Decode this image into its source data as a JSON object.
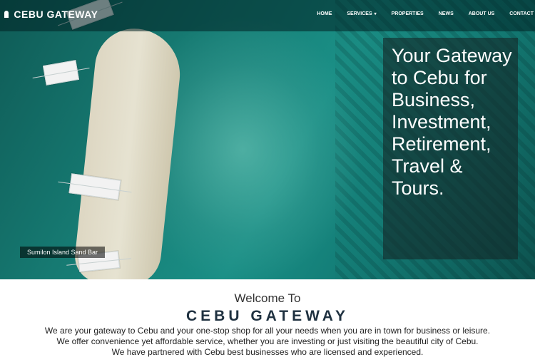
{
  "brand": {
    "name": "CEBU GATEWAY"
  },
  "nav": {
    "items": [
      {
        "label": "HOME"
      },
      {
        "label": "SERVICES"
      },
      {
        "label": "PROPERTIES"
      },
      {
        "label": "NEWS"
      },
      {
        "label": "ABOUT US"
      },
      {
        "label": "CONTACT"
      }
    ]
  },
  "hero": {
    "tagline": "Your Gateway to Cebu for Business, Investment, Retirement, Travel & Tours.",
    "caption": "Sumilon Island Sand Bar"
  },
  "welcome": {
    "heading": "Welcome To",
    "title": "CEBU GATEWAY",
    "lines": [
      "We are your gateway to Cebu and your one-stop shop for all your needs when you are in town for business or leisure.",
      "We offer convenience yet affordable service, whether you are investing or just visiting the beautiful city of Cebu.",
      "We have partnered with Cebu best businesses who are licensed and experienced."
    ]
  },
  "icons": {
    "logo": "pin-logo-icon",
    "dropdown": "chevron-down-icon"
  }
}
